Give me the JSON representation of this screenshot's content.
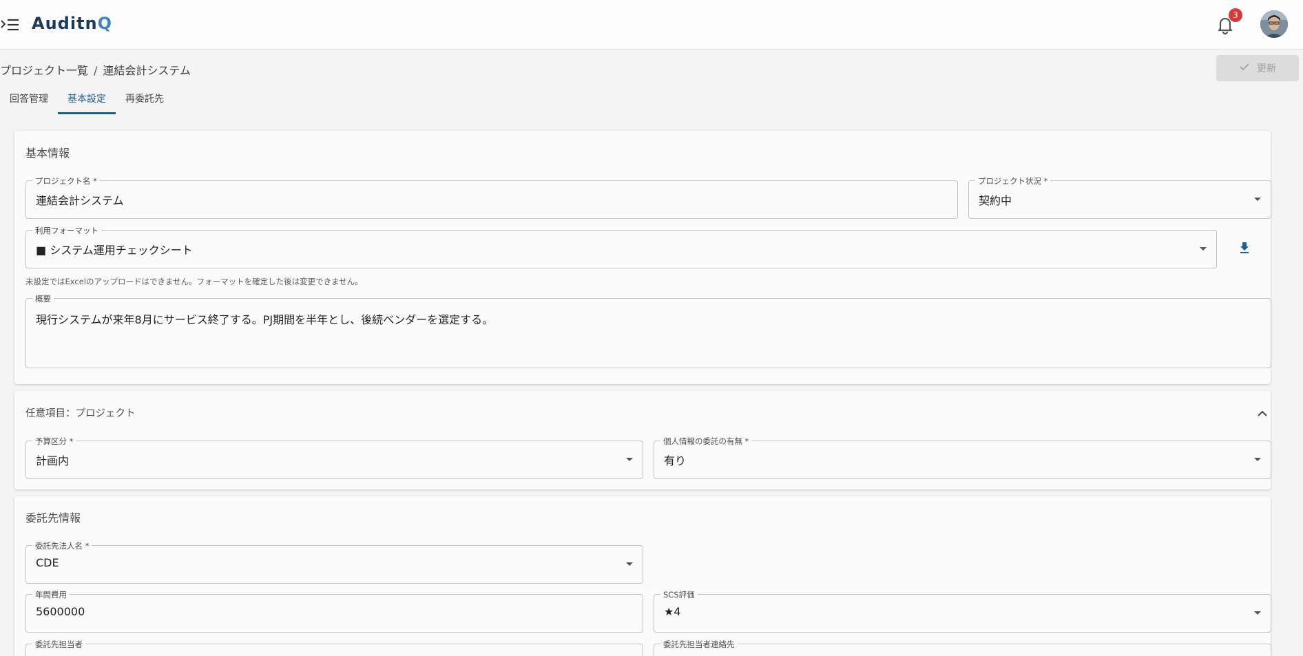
{
  "header": {
    "logo_main": "Auditn",
    "logo_accent": "Q",
    "notification_count": "3"
  },
  "breadcrumb": {
    "parent": "プロジェクト一覧",
    "separator": "/",
    "current": "連結会計システム"
  },
  "actions": {
    "update_label": "更新"
  },
  "tabs": [
    {
      "label": "回答管理",
      "active": false
    },
    {
      "label": "基本設定",
      "active": true
    },
    {
      "label": "再委託先",
      "active": false
    }
  ],
  "basic_info": {
    "title": "基本情報",
    "project_name": {
      "label": "プロジェクト名 *",
      "value": "連結会計システム"
    },
    "project_status": {
      "label": "プロジェクト状況 *",
      "value": "契約中"
    },
    "format": {
      "label": "利用フォーマット",
      "value": "■ システム運用チェックシート"
    },
    "format_helper": "未設定ではExcelのアップロードはできません。フォーマットを確定した後は変更できません。",
    "summary": {
      "label": "概要",
      "value": "現行システムが来年8月にサービス終了する。PJ期間を半年とし、後続ベンダーを選定する。"
    }
  },
  "optional_project": {
    "title": "任意項目：プロジェクト",
    "budget": {
      "label": "予算区分 *",
      "value": "計画内"
    },
    "personal_info": {
      "label": "個人情報の委託の有無 *",
      "value": "有り"
    }
  },
  "contractor": {
    "title": "委託先情報",
    "company": {
      "label": "委託先法人名 *",
      "value": "CDE"
    },
    "annual_cost": {
      "label": "年間費用",
      "value": "5600000"
    },
    "scs": {
      "label": "SCS評価",
      "value": "★4"
    },
    "contact_person": {
      "label": "委託先担当者",
      "value": ""
    },
    "contact_info": {
      "label": "委託先担当者連絡先",
      "value": ""
    }
  },
  "colors": {
    "accent": "#1f5f8f",
    "badge": "#d33a3a",
    "background": "#f4f4f4"
  }
}
